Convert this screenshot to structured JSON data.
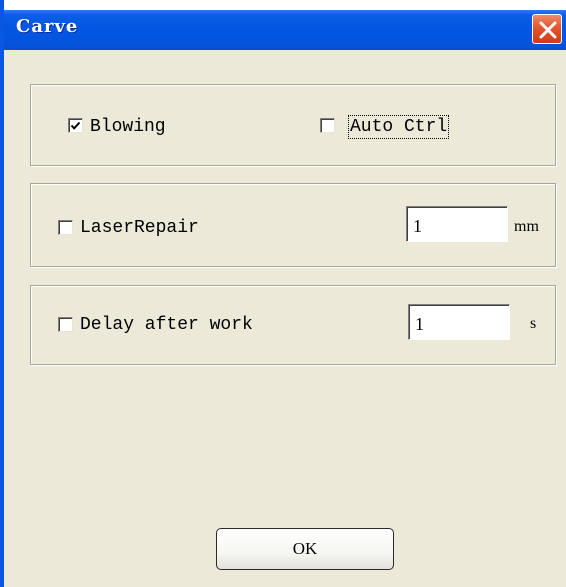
{
  "window": {
    "title": "Carve",
    "close_icon": "close-icon"
  },
  "blowing": {
    "label": "Blowing",
    "checked": true
  },
  "auto_ctrl": {
    "label": "Auto Ctrl",
    "checked": false,
    "focused": true
  },
  "laser_repair": {
    "label": "LaserRepair",
    "checked": false,
    "value": "1",
    "unit": "mm"
  },
  "delay_after_work": {
    "label": "Delay after work",
    "checked": false,
    "value": "1",
    "unit": "s"
  },
  "buttons": {
    "ok_label": "OK"
  },
  "colors": {
    "titlebar": "#0355e1",
    "dialog_bg": "#ece9d8",
    "close_button": "#e2552f"
  }
}
